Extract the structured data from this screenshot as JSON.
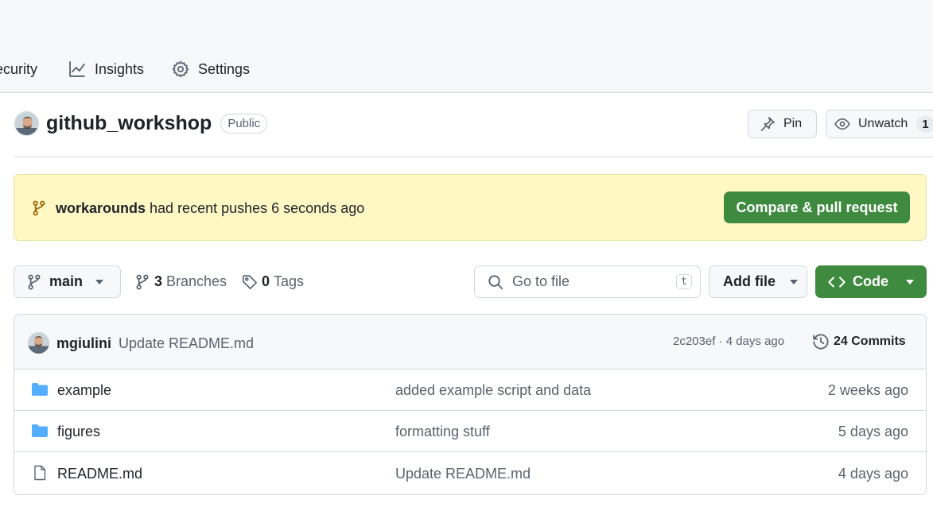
{
  "nav": {
    "items": [
      {
        "label": "ecurity",
        "icon": "shield-icon"
      },
      {
        "label": "Insights",
        "icon": "graph-icon"
      },
      {
        "label": "Settings",
        "icon": "gear-icon"
      }
    ]
  },
  "repo": {
    "name": "github_workshop",
    "visibility": "Public",
    "pin_label": "Pin",
    "watch_label": "Unwatch",
    "watch_count": "1"
  },
  "banner": {
    "branch": "workarounds",
    "message": " had recent pushes 6 seconds ago",
    "button": "Compare & pull request"
  },
  "toolbar": {
    "branch": "main",
    "branches_count": "3",
    "branches_label": "Branches",
    "tags_count": "0",
    "tags_label": "Tags",
    "search_placeholder": "Go to file",
    "search_shortcut": "t",
    "add_file": "Add file",
    "code": "Code"
  },
  "latest_commit": {
    "author": "mgiulini",
    "message": "Update README.md",
    "hash_time": "2c203ef · 4 days ago",
    "commits_label": "24 Commits"
  },
  "files": [
    {
      "type": "folder",
      "icon": "folder-icon",
      "name": "example",
      "commit": "added example script and data",
      "date": "2 weeks ago"
    },
    {
      "type": "folder",
      "icon": "folder-icon",
      "name": "figures",
      "commit": "formatting stuff",
      "date": "5 days ago"
    },
    {
      "type": "file",
      "icon": "file-icon",
      "name": "README.md",
      "commit": "Update README.md",
      "date": "4 days ago"
    }
  ],
  "colors": {
    "accent_green": "#3e8a3f",
    "folder_blue": "#54aeff",
    "banner_bg": "#fff8c5"
  }
}
